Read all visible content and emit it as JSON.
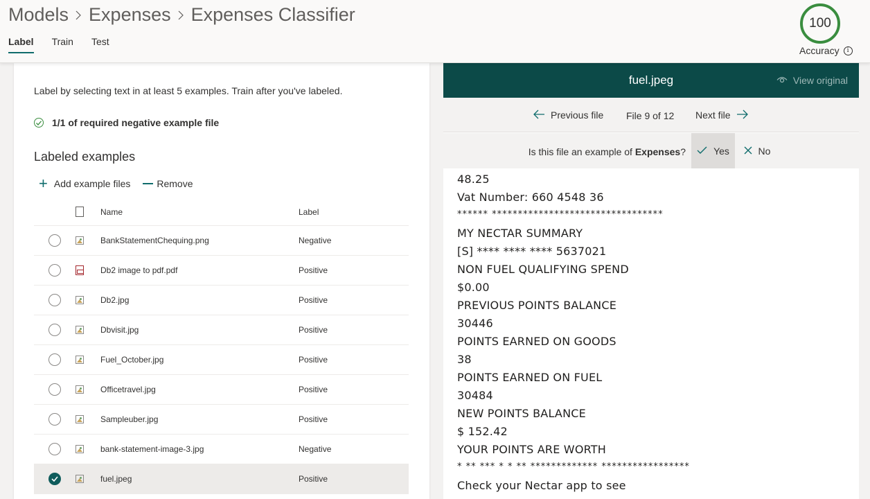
{
  "breadcrumb": [
    "Models",
    "Expenses",
    "Expenses Classifier"
  ],
  "tabs": [
    {
      "label": "Label",
      "active": true
    },
    {
      "label": "Train",
      "active": false
    },
    {
      "label": "Test",
      "active": false
    }
  ],
  "accuracy": {
    "value": "100",
    "label": "Accuracy"
  },
  "left": {
    "instructions": "Label by selecting text in at least 5 examples. Train after you've labeled.",
    "status": "1/1 of required negative example file",
    "section_title": "Labeled examples",
    "add_label": "Add example files",
    "remove_label": "Remove",
    "columns": {
      "name": "Name",
      "label": "Label"
    },
    "rows": [
      {
        "name": "BankStatementChequing.png",
        "label": "Negative",
        "type": "image",
        "selected": false
      },
      {
        "name": "Db2 image to pdf.pdf",
        "label": "Positive",
        "type": "pdf",
        "selected": false
      },
      {
        "name": "Db2.jpg",
        "label": "Positive",
        "type": "image",
        "selected": false
      },
      {
        "name": "Dbvisit.jpg",
        "label": "Positive",
        "type": "image",
        "selected": false
      },
      {
        "name": "Fuel_October.jpg",
        "label": "Positive",
        "type": "image",
        "selected": false
      },
      {
        "name": "Officetravel.jpg",
        "label": "Positive",
        "type": "image",
        "selected": false
      },
      {
        "name": "Sampleuber.jpg",
        "label": "Positive",
        "type": "image",
        "selected": false
      },
      {
        "name": "bank-statement-image-3.jpg",
        "label": "Negative",
        "type": "image",
        "selected": false
      },
      {
        "name": "fuel.jpeg",
        "label": "Positive",
        "type": "image",
        "selected": true
      }
    ]
  },
  "right": {
    "file_title": "fuel.jpeg",
    "view_original": "View original",
    "prev_label": "Previous file",
    "file_count": "File 9 of 12",
    "next_label": "Next file",
    "question_prefix": "Is this file an example of ",
    "question_model": "Expenses",
    "question_suffix": "?",
    "yes_label": "Yes",
    "no_label": "No",
    "doc_lines": [
      "48.25",
      "Vat Number: 660 4548 36",
      "****** *********************************",
      "MY NECTAR SUMMARY",
      "[S] **** **** **** 5637021",
      "NON FUEL QUALIFYING SPEND",
      "$0.00",
      "PREVIOUS POINTS BALANCE",
      "30446",
      "POINTS EARNED ON GOODS",
      "38",
      "POINTS EARNED ON FUEL",
      "30484",
      "NEW POINTS BALANCE",
      "$ 152.42",
      "YOUR POINTS ARE WORTH",
      "* ** *** * * ** ************* *****************",
      "Check your Nectar app to see"
    ]
  },
  "colors": {
    "accent": "#0f6c6c",
    "header_dark": "#0c4a48",
    "success": "#3a8d3f"
  }
}
